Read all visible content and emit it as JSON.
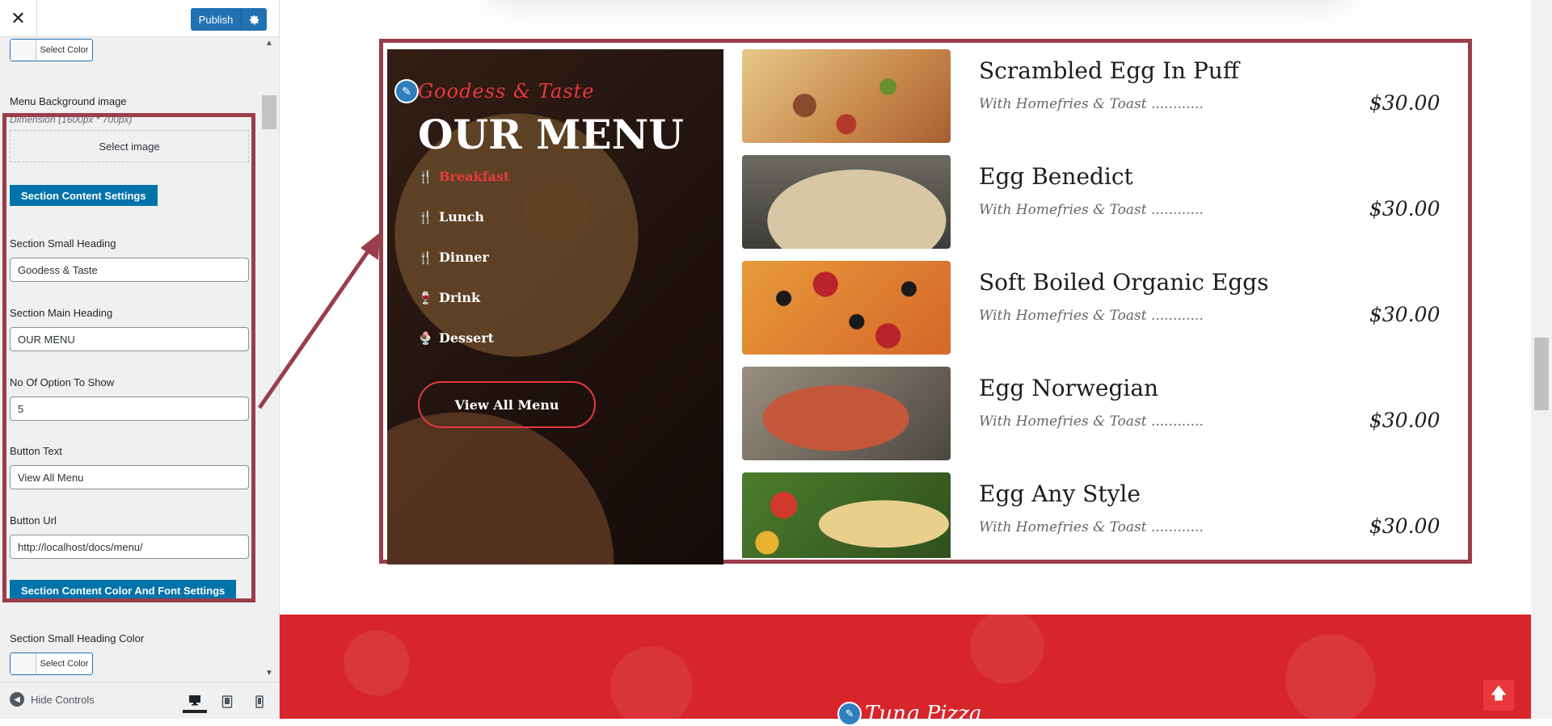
{
  "header": {
    "close_icon": "close-icon",
    "publish_label": "Publish",
    "settings_icon": "gear-icon"
  },
  "sidebar": {
    "top_select_color": "Select Color",
    "bg_image": {
      "label": "Menu Background image",
      "description": "Dimension (1600px * 700px)",
      "button": "Select image"
    },
    "content_settings_button": "Section Content Settings",
    "small_heading": {
      "label": "Section Small Heading",
      "value": "Goodess & Taste"
    },
    "main_heading": {
      "label": "Section Main Heading",
      "value": "OUR MENU"
    },
    "options": {
      "label": "No Of Option To Show",
      "value": "5"
    },
    "button_text": {
      "label": "Button Text",
      "value": "View All Menu"
    },
    "button_url": {
      "label": "Button Url",
      "value": "http://localhost/docs/menu/"
    },
    "color_font_button": "Section Content Color And Font Settings",
    "small_heading_color": {
      "label": "Section Small Heading Color",
      "select": "Select Color"
    }
  },
  "footer_controls": {
    "hide_controls": "Hide Controls",
    "devices": [
      "desktop-icon",
      "tablet-icon",
      "mobile-icon"
    ]
  },
  "preview": {
    "small_heading": "Goodess & Taste",
    "main_heading": "OUR MENU",
    "categories": [
      {
        "label": "Breakfast",
        "icon": "utensils-icon",
        "active": true
      },
      {
        "label": "Lunch",
        "icon": "utensils-icon",
        "active": false
      },
      {
        "label": "Dinner",
        "icon": "utensils-icon",
        "active": false
      },
      {
        "label": "Drink",
        "icon": "glass-icon",
        "active": false
      },
      {
        "label": "Dessert",
        "icon": "ice-cream-icon",
        "active": false
      }
    ],
    "view_all_button": "View All Menu",
    "dishes": [
      {
        "name": "Scrambled Egg In Puff",
        "desc": "With Homefries & Toast ............",
        "price": "$30.00"
      },
      {
        "name": "Egg Benedict",
        "desc": "With Homefries & Toast ............",
        "price": "$30.00"
      },
      {
        "name": "Soft Boiled Organic Eggs",
        "desc": "With Homefries & Toast ............",
        "price": "$30.00"
      },
      {
        "name": "Egg Norwegian",
        "desc": "With Homefries & Toast ............",
        "price": "$30.00"
      },
      {
        "name": "Egg Any Style",
        "desc": "With Homefries & Toast ............",
        "price": "$30.00"
      }
    ],
    "footer_logo": "Tung Pizza",
    "accent_color": "#e8383d",
    "highlight_color": "#9b3d4b",
    "footer_color": "#d7262b"
  }
}
